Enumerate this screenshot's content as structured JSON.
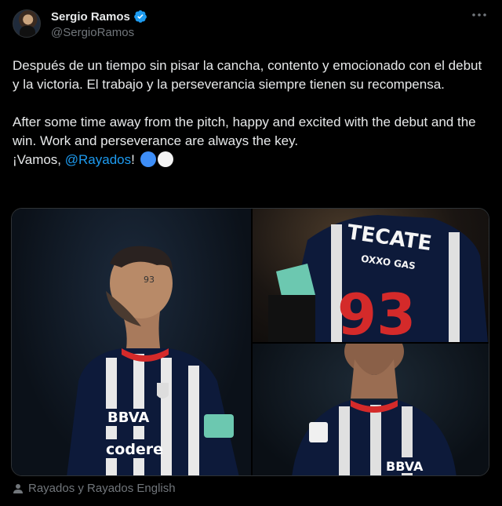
{
  "author": {
    "display_name": "Sergio Ramos",
    "handle": "@SergioRamos",
    "verified": true
  },
  "more_icon": "more-horizontal-icon",
  "tweet": {
    "para1": "Después de un tiempo sin pisar la cancha, contento y emocionado con el debut y la victoria. El trabajo y la perseverancia siempre tienen su recompensa.",
    "para2_line1": "After some time away from the pitch, happy and excited with the debut and the win. Work and perseverance are always the key.",
    "vamos": "¡Vamos, ",
    "mention": "@Rayados",
    "exclaim": "!",
    "emojis": [
      "blue-circle",
      "white-circle"
    ]
  },
  "media": {
    "jersey_sponsor": "TECATE",
    "jersey_sub_sponsor": "OXXO GAS",
    "jersey_number": "93",
    "shirt_sponsor": "BBVA",
    "shirt_sponsor_2": "codere",
    "neck_number": "93"
  },
  "caption": {
    "text": "Rayados y Rayados English",
    "icon": "person-icon"
  },
  "colors": {
    "background": "#000000",
    "text": "#e7e9ea",
    "secondary": "#71767b",
    "link": "#1d9bf0",
    "jersey_red": "#d42a2a"
  }
}
